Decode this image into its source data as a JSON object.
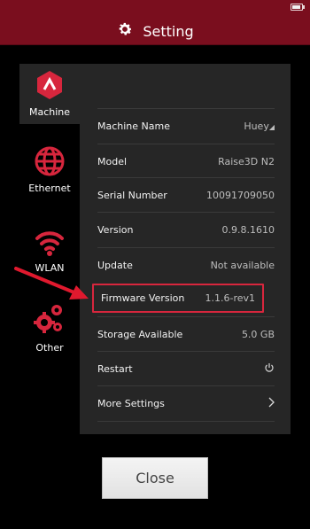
{
  "header": {
    "title": "Setting",
    "title_icon": "gear-icon",
    "battery_icon": "battery-icon"
  },
  "sidebar": {
    "items": [
      {
        "label": "Machine",
        "icon": "raise3d-logo-icon",
        "active": true
      },
      {
        "label": "Ethernet",
        "icon": "globe-icon",
        "active": false
      },
      {
        "label": "WLAN",
        "icon": "wifi-icon",
        "active": false
      },
      {
        "label": "Other",
        "icon": "gears-icon",
        "active": false
      }
    ]
  },
  "settings": {
    "rows": [
      {
        "label": "Machine Name",
        "value": "Huey"
      },
      {
        "label": "Model",
        "value": "Raise3D N2"
      },
      {
        "label": "Serial Number",
        "value": "10091709050"
      },
      {
        "label": "Version",
        "value": "0.9.8.1610"
      },
      {
        "label": "Update",
        "value": "Not available"
      },
      {
        "label": "Firmware Version",
        "value": "1.1.6-rev1"
      },
      {
        "label": "Storage Available",
        "value": "5.0 GB"
      },
      {
        "label": "Restart",
        "value": ""
      },
      {
        "label": "More Settings",
        "value": ""
      }
    ]
  },
  "footer": {
    "close_label": "Close"
  },
  "colors": {
    "brand": "#7a0e1e",
    "accent": "#d7263d",
    "panel": "#262626"
  }
}
